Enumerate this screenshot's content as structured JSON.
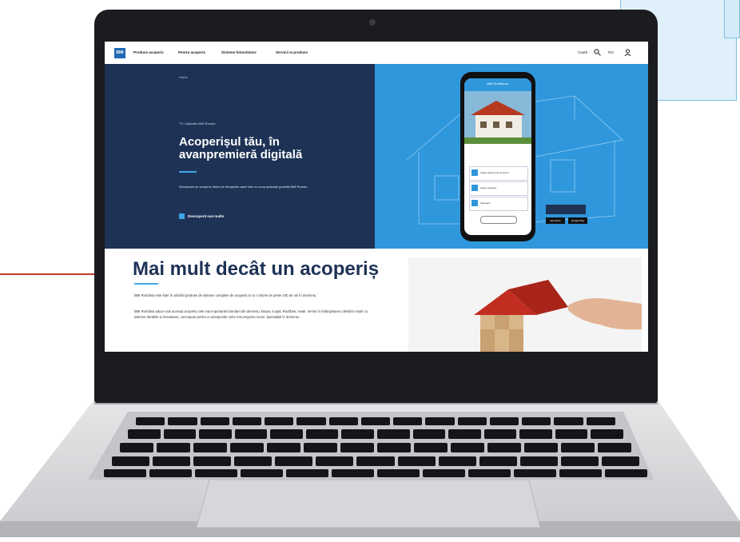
{
  "nav": {
    "logo_text": "BMI",
    "links": [
      "Produse acoperis",
      "Pentru acoperis",
      "Sisteme fotovoltaice",
      "Servicii si produse"
    ],
    "right_label": "Caută",
    "lang": "RO"
  },
  "hero": {
    "breadcrumb": "Home",
    "eyebrow": "TV / Aplicatia BMI Roman",
    "title_line1": "Acoperișul tău, în",
    "title_line2": "avanpremieră digitală",
    "description": "Simulează un acoperiș direct pe fotografia casei tale cu noua aplicație gratuită BMI Roman.",
    "cta": "Descoperă mai multe"
  },
  "phone": {
    "header": "BMI RoofDecor",
    "rows": [
      "Alege sistemul de acoperis",
      "Alege culoarea",
      "Salveaza"
    ],
    "badges": [
      "App Store",
      "Google Play"
    ]
  },
  "section": {
    "title": "Mai mult decât un acoperiș",
    "p1": "BMI România este lider în vânzări produse de sisteme complete de acoperiș și cu o istorie de peste 100 de ani în domeniu.",
    "p2": "BMI România aduce sub aceeași acoperiș cele mai importante branduri din domeniu: Braas, Icopal, RoofDek, Awak. Venim în întâmpinarea clienților noștri cu sisteme durabile și inovatoare, concepute pentru a corespunde celor mai exigente nevoi. Specialiști în domeniu."
  },
  "colors": {
    "hero_dark": "#1e3256",
    "hero_blue": "#2f97dc",
    "accent": "#3fa7e6",
    "brand": "#1f69b5",
    "deco_red": "#c63a2c"
  },
  "icons": [
    "search-icon",
    "user-icon",
    "menu-icon"
  ]
}
